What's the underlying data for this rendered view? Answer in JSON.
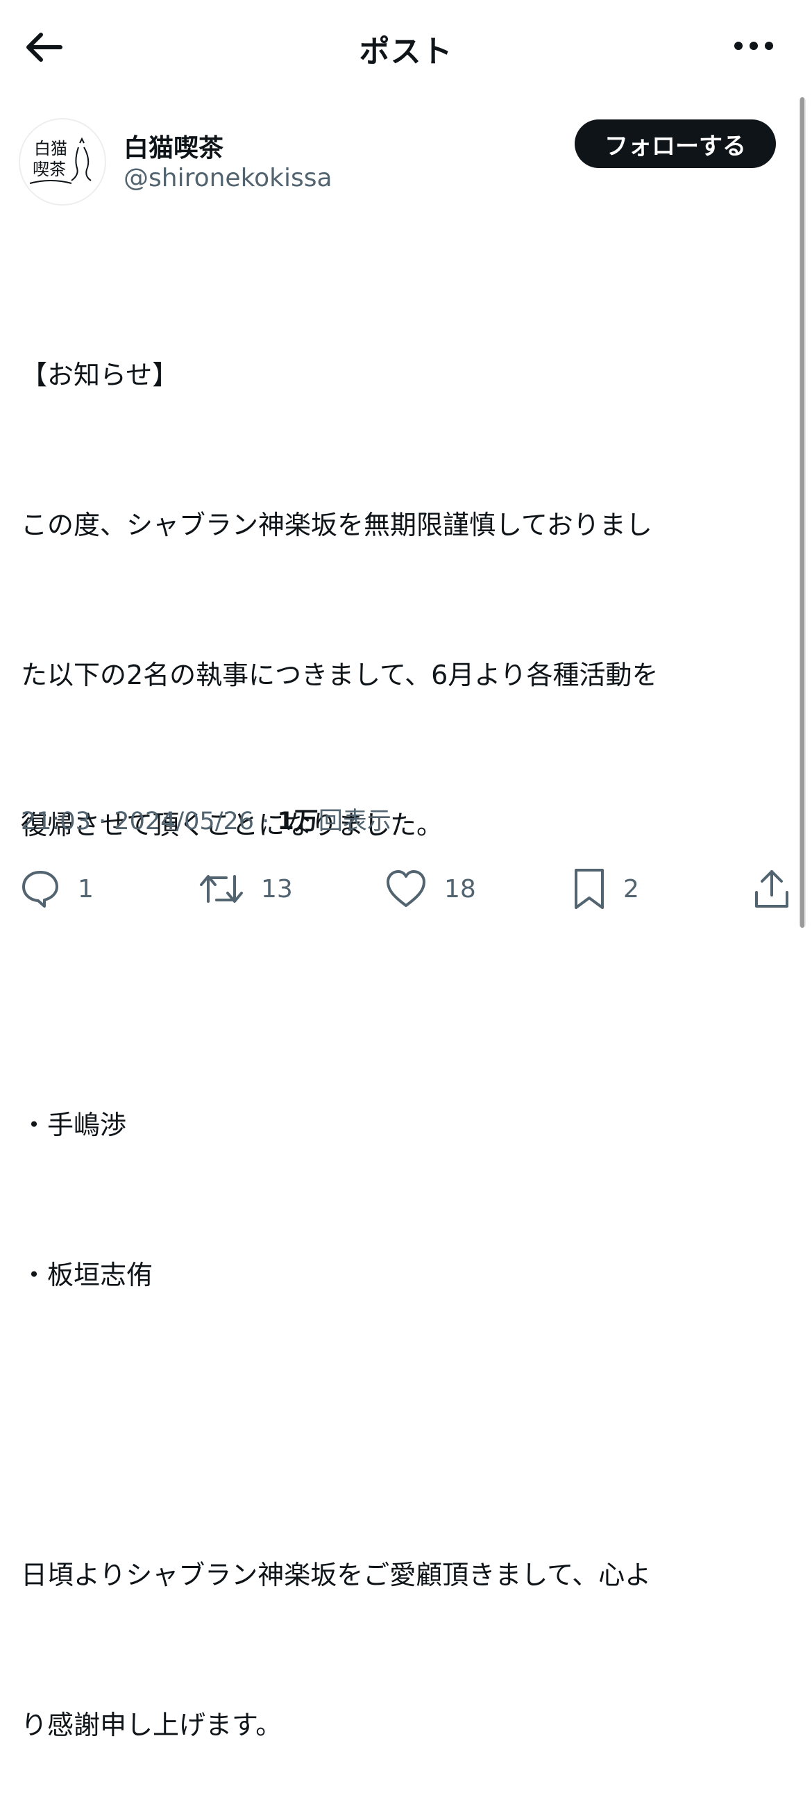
{
  "header": {
    "title": "ポスト",
    "back_icon": "arrow-left-icon",
    "more_icon": "more-horizontal-icon"
  },
  "author": {
    "display_name": "白猫喫茶",
    "handle": "@shironekokissa",
    "avatar_text_line1": "白猫",
    "avatar_text_line2": "喫茶",
    "follow_label": "フォローする"
  },
  "post": {
    "lines": [
      "【お知らせ】",
      "この度、シャブラン神楽坂を無期限謹慎しておりまし",
      "た以下の2名の執事につきまして、6月より各種活動を",
      "復帰させて頂くことになりました。",
      "",
      "・手嶋渉",
      "・板垣志侑",
      "",
      "日頃よりシャブラン神楽坂をご愛顧頂きまして、心よ",
      "り感謝申し上げます。"
    ],
    "time": "21:03",
    "separator": "·",
    "date": "2024/05/26",
    "views_count": "1万",
    "views_label": "回表示"
  },
  "actions": {
    "reply_count": "1",
    "repost_count": "13",
    "like_count": "18",
    "bookmark_count": "2"
  },
  "colors": {
    "text": "#0f1419",
    "secondary": "#536471",
    "button_bg": "#0f1419"
  }
}
